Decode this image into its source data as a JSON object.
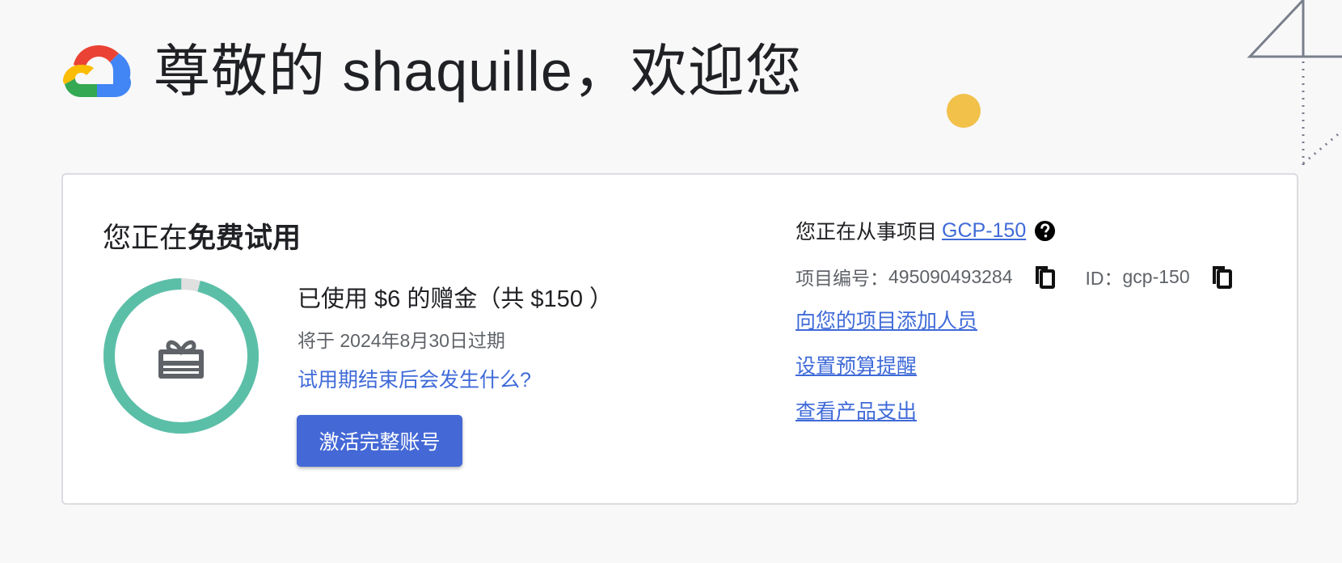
{
  "header": {
    "logo_icon": "google-cloud-logo",
    "welcome": "尊敬的 shaquille，欢迎您"
  },
  "trial": {
    "title_prefix": "您正在",
    "title_bold": "免费试用",
    "used_fraction": 0.04,
    "ring_color": "#5bbfa8",
    "credit_text": "已使用 $6 的赠金（共 $150 ）",
    "expire_text": "将于 2024年8月30日过期",
    "faq_link": "试用期结束后会发生什么?",
    "activate_button": "激活完整账号",
    "gift_icon": "gift-card-icon"
  },
  "project": {
    "label": "您正在从事项目",
    "name": "GCP-150",
    "number_label": "项目编号：",
    "number": "495090493284",
    "id_label": "ID：",
    "id": "gcp-150",
    "links": [
      "向您的项目添加人员",
      "设置预算提醒",
      "查看产品支出"
    ]
  },
  "colors": {
    "accent": "#4468d6",
    "link": "#3f6ad8",
    "ring": "#5bbfa8",
    "decor_yellow": "#f1c14a"
  }
}
